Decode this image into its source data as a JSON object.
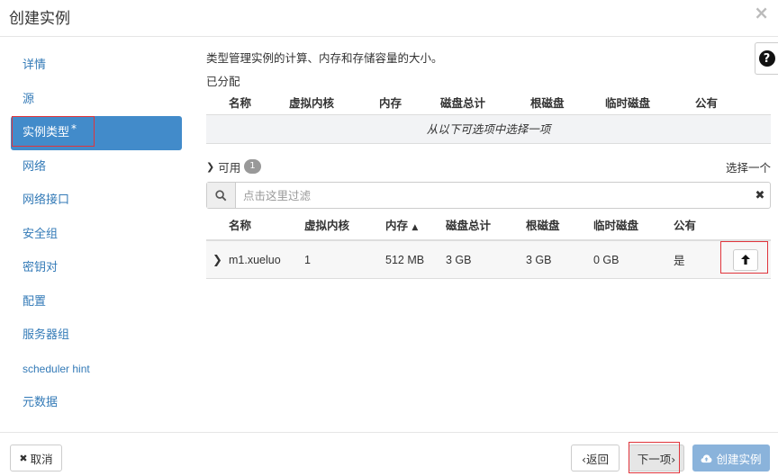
{
  "dialog": {
    "title": "创建实例",
    "close_icon": "×"
  },
  "sidebar": {
    "items": [
      {
        "label": "详情"
      },
      {
        "label": "源"
      },
      {
        "label": "实例类型",
        "required": "*"
      },
      {
        "label": "网络"
      },
      {
        "label": "网络接口"
      },
      {
        "label": "安全组"
      },
      {
        "label": "密钥对"
      },
      {
        "label": "配置"
      },
      {
        "label": "服务器组"
      },
      {
        "label": "scheduler hint"
      },
      {
        "label": "元数据"
      }
    ]
  },
  "help": {
    "icon": "?"
  },
  "content": {
    "description": "类型管理实例的计算、内存和存储容量的大小。",
    "allocated": {
      "title": "已分配",
      "columns": [
        "名称",
        "虚拟内核",
        "内存",
        "磁盘总计",
        "根磁盘",
        "临时磁盘",
        "公有"
      ],
      "empty_message": "从以下可选项中选择一项"
    },
    "available": {
      "title": "可用",
      "count": "1",
      "select_hint": "选择一个",
      "filter_placeholder": "点击这里过滤",
      "columns": [
        "名称",
        "虚拟内核",
        "内存",
        "磁盘总计",
        "根磁盘",
        "临时磁盘",
        "公有"
      ],
      "sort_indicator": "▲",
      "rows": [
        {
          "name": "m1.xueluo",
          "vcpus": "1",
          "ram": "512 MB",
          "total_disk": "3 GB",
          "root_disk": "3 GB",
          "ephemeral_disk": "0 GB",
          "public": "是"
        }
      ]
    }
  },
  "footer": {
    "cancel": "取消",
    "back": "‹返回",
    "next": "下一项›",
    "create": "创建实例"
  },
  "colors": {
    "accent": "#428bca",
    "link": "#337ab7",
    "highlight": "#e0343b"
  }
}
